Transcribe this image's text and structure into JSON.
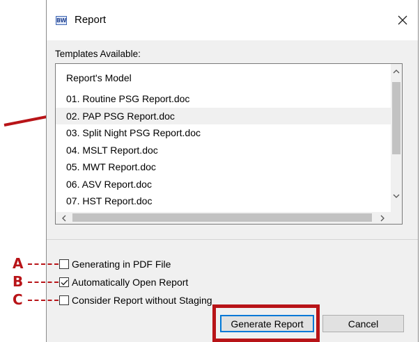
{
  "window": {
    "title": "Report",
    "app_icon_text": "BW"
  },
  "templates": {
    "label": "Templates Available:",
    "header": "Report's Model",
    "items": [
      "01. Routine PSG Report.doc",
      "02. PAP PSG Report.doc",
      "03. Split Night PSG Report.doc",
      "04. MSLT Report.doc",
      "05. MWT Report.doc",
      "06. ASV Report.doc",
      "07. HST Report.doc"
    ],
    "selected_index": 1
  },
  "options": [
    {
      "marker": "A",
      "label": "Generating in PDF File",
      "checked": false
    },
    {
      "marker": "B",
      "label": "Automatically Open Report",
      "checked": true
    },
    {
      "marker": "C",
      "label": "Consider Report without Staging",
      "checked": false
    }
  ],
  "buttons": {
    "generate": "Generate Report",
    "cancel": "Cancel"
  },
  "annotation": {
    "color": "#b81418"
  }
}
